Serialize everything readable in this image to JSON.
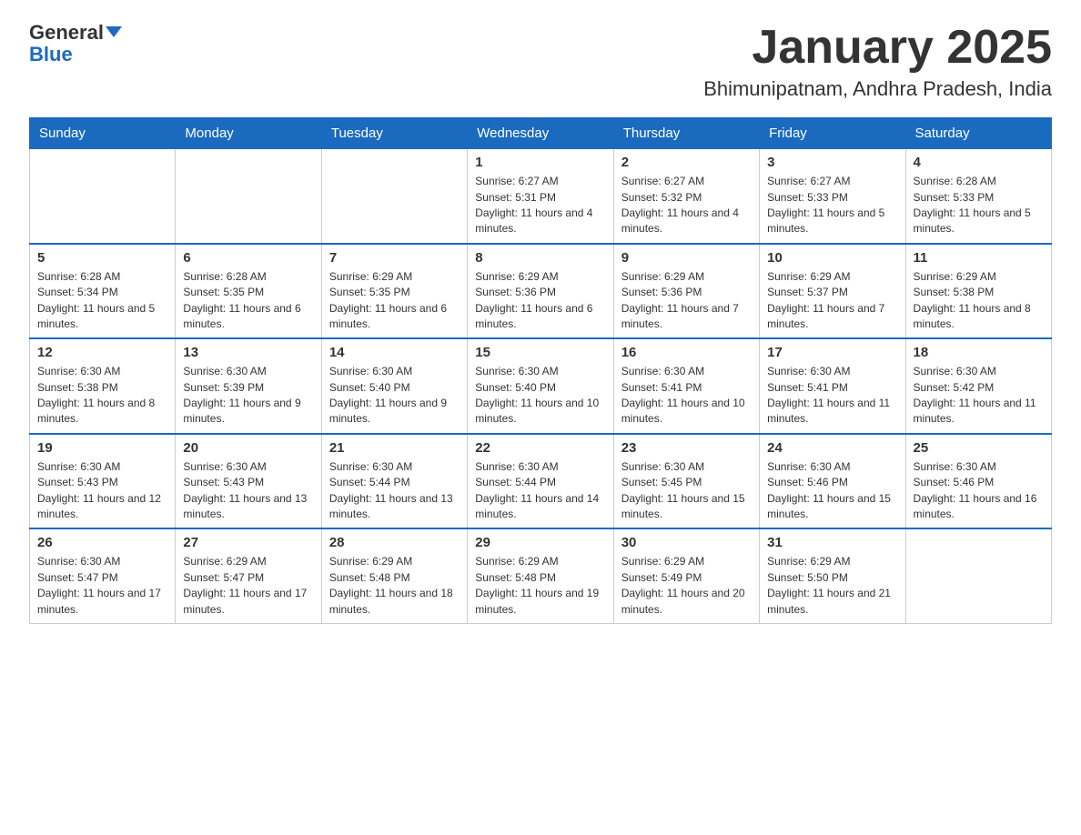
{
  "header": {
    "logo_text1": "General",
    "logo_text2": "Blue",
    "month_title": "January 2025",
    "location": "Bhimunipatnam, Andhra Pradesh, India"
  },
  "days_of_week": [
    "Sunday",
    "Monday",
    "Tuesday",
    "Wednesday",
    "Thursday",
    "Friday",
    "Saturday"
  ],
  "weeks": [
    [
      {
        "day": "",
        "info": ""
      },
      {
        "day": "",
        "info": ""
      },
      {
        "day": "",
        "info": ""
      },
      {
        "day": "1",
        "info": "Sunrise: 6:27 AM\nSunset: 5:31 PM\nDaylight: 11 hours and 4 minutes."
      },
      {
        "day": "2",
        "info": "Sunrise: 6:27 AM\nSunset: 5:32 PM\nDaylight: 11 hours and 4 minutes."
      },
      {
        "day": "3",
        "info": "Sunrise: 6:27 AM\nSunset: 5:33 PM\nDaylight: 11 hours and 5 minutes."
      },
      {
        "day": "4",
        "info": "Sunrise: 6:28 AM\nSunset: 5:33 PM\nDaylight: 11 hours and 5 minutes."
      }
    ],
    [
      {
        "day": "5",
        "info": "Sunrise: 6:28 AM\nSunset: 5:34 PM\nDaylight: 11 hours and 5 minutes."
      },
      {
        "day": "6",
        "info": "Sunrise: 6:28 AM\nSunset: 5:35 PM\nDaylight: 11 hours and 6 minutes."
      },
      {
        "day": "7",
        "info": "Sunrise: 6:29 AM\nSunset: 5:35 PM\nDaylight: 11 hours and 6 minutes."
      },
      {
        "day": "8",
        "info": "Sunrise: 6:29 AM\nSunset: 5:36 PM\nDaylight: 11 hours and 6 minutes."
      },
      {
        "day": "9",
        "info": "Sunrise: 6:29 AM\nSunset: 5:36 PM\nDaylight: 11 hours and 7 minutes."
      },
      {
        "day": "10",
        "info": "Sunrise: 6:29 AM\nSunset: 5:37 PM\nDaylight: 11 hours and 7 minutes."
      },
      {
        "day": "11",
        "info": "Sunrise: 6:29 AM\nSunset: 5:38 PM\nDaylight: 11 hours and 8 minutes."
      }
    ],
    [
      {
        "day": "12",
        "info": "Sunrise: 6:30 AM\nSunset: 5:38 PM\nDaylight: 11 hours and 8 minutes."
      },
      {
        "day": "13",
        "info": "Sunrise: 6:30 AM\nSunset: 5:39 PM\nDaylight: 11 hours and 9 minutes."
      },
      {
        "day": "14",
        "info": "Sunrise: 6:30 AM\nSunset: 5:40 PM\nDaylight: 11 hours and 9 minutes."
      },
      {
        "day": "15",
        "info": "Sunrise: 6:30 AM\nSunset: 5:40 PM\nDaylight: 11 hours and 10 minutes."
      },
      {
        "day": "16",
        "info": "Sunrise: 6:30 AM\nSunset: 5:41 PM\nDaylight: 11 hours and 10 minutes."
      },
      {
        "day": "17",
        "info": "Sunrise: 6:30 AM\nSunset: 5:41 PM\nDaylight: 11 hours and 11 minutes."
      },
      {
        "day": "18",
        "info": "Sunrise: 6:30 AM\nSunset: 5:42 PM\nDaylight: 11 hours and 11 minutes."
      }
    ],
    [
      {
        "day": "19",
        "info": "Sunrise: 6:30 AM\nSunset: 5:43 PM\nDaylight: 11 hours and 12 minutes."
      },
      {
        "day": "20",
        "info": "Sunrise: 6:30 AM\nSunset: 5:43 PM\nDaylight: 11 hours and 13 minutes."
      },
      {
        "day": "21",
        "info": "Sunrise: 6:30 AM\nSunset: 5:44 PM\nDaylight: 11 hours and 13 minutes."
      },
      {
        "day": "22",
        "info": "Sunrise: 6:30 AM\nSunset: 5:44 PM\nDaylight: 11 hours and 14 minutes."
      },
      {
        "day": "23",
        "info": "Sunrise: 6:30 AM\nSunset: 5:45 PM\nDaylight: 11 hours and 15 minutes."
      },
      {
        "day": "24",
        "info": "Sunrise: 6:30 AM\nSunset: 5:46 PM\nDaylight: 11 hours and 15 minutes."
      },
      {
        "day": "25",
        "info": "Sunrise: 6:30 AM\nSunset: 5:46 PM\nDaylight: 11 hours and 16 minutes."
      }
    ],
    [
      {
        "day": "26",
        "info": "Sunrise: 6:30 AM\nSunset: 5:47 PM\nDaylight: 11 hours and 17 minutes."
      },
      {
        "day": "27",
        "info": "Sunrise: 6:29 AM\nSunset: 5:47 PM\nDaylight: 11 hours and 17 minutes."
      },
      {
        "day": "28",
        "info": "Sunrise: 6:29 AM\nSunset: 5:48 PM\nDaylight: 11 hours and 18 minutes."
      },
      {
        "day": "29",
        "info": "Sunrise: 6:29 AM\nSunset: 5:48 PM\nDaylight: 11 hours and 19 minutes."
      },
      {
        "day": "30",
        "info": "Sunrise: 6:29 AM\nSunset: 5:49 PM\nDaylight: 11 hours and 20 minutes."
      },
      {
        "day": "31",
        "info": "Sunrise: 6:29 AM\nSunset: 5:50 PM\nDaylight: 11 hours and 21 minutes."
      },
      {
        "day": "",
        "info": ""
      }
    ]
  ]
}
